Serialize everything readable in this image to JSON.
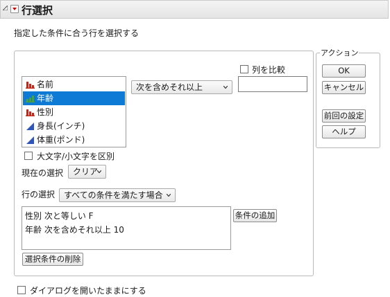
{
  "header": {
    "title": "行選択"
  },
  "description": "指定した条件に合う行を選択する",
  "columns": [
    {
      "label": "名前",
      "icon": "nominal-bar-icon",
      "selected": false
    },
    {
      "label": "年齢",
      "icon": "ordinal-bar-icon",
      "selected": true
    },
    {
      "label": "性別",
      "icon": "nominal-bar-icon",
      "selected": false
    },
    {
      "label": "身長(インチ)",
      "icon": "continuous-triangle-icon",
      "selected": false
    },
    {
      "label": "体重(ポンド)",
      "icon": "continuous-triangle-icon",
      "selected": false
    }
  ],
  "condition_dropdown": {
    "value": "次を含めそれ以上"
  },
  "compare_columns": {
    "label": "列を比較",
    "checked": false
  },
  "value_input": {
    "value": ""
  },
  "case_sensitive": {
    "label": "大文字/小文字を区別",
    "checked": false
  },
  "current_selection": {
    "label": "現在の選択",
    "value": "クリア"
  },
  "row_selection": {
    "label": "行の選択",
    "value": "すべての条件を満たす場合"
  },
  "conditions": [
    "性別 次と等しい F",
    "年齢 次を含めそれ以上 10"
  ],
  "buttons": {
    "add_condition": "条件の追加",
    "remove_selected": "選択条件の削除"
  },
  "actions": {
    "label": "アクション",
    "ok": "OK",
    "cancel": "キャンセル",
    "recall": "前回の設定",
    "help": "ヘルプ"
  },
  "keep_open": {
    "label": "ダイアログを開いたままにする",
    "checked": false
  },
  "colors": {
    "selection": "#0d7bd6",
    "nominal_icon": "#c0281b",
    "ordinal_icon": "#4aa336",
    "continuous_icon": "#2f56b8",
    "red_menu": "#cc0000"
  }
}
